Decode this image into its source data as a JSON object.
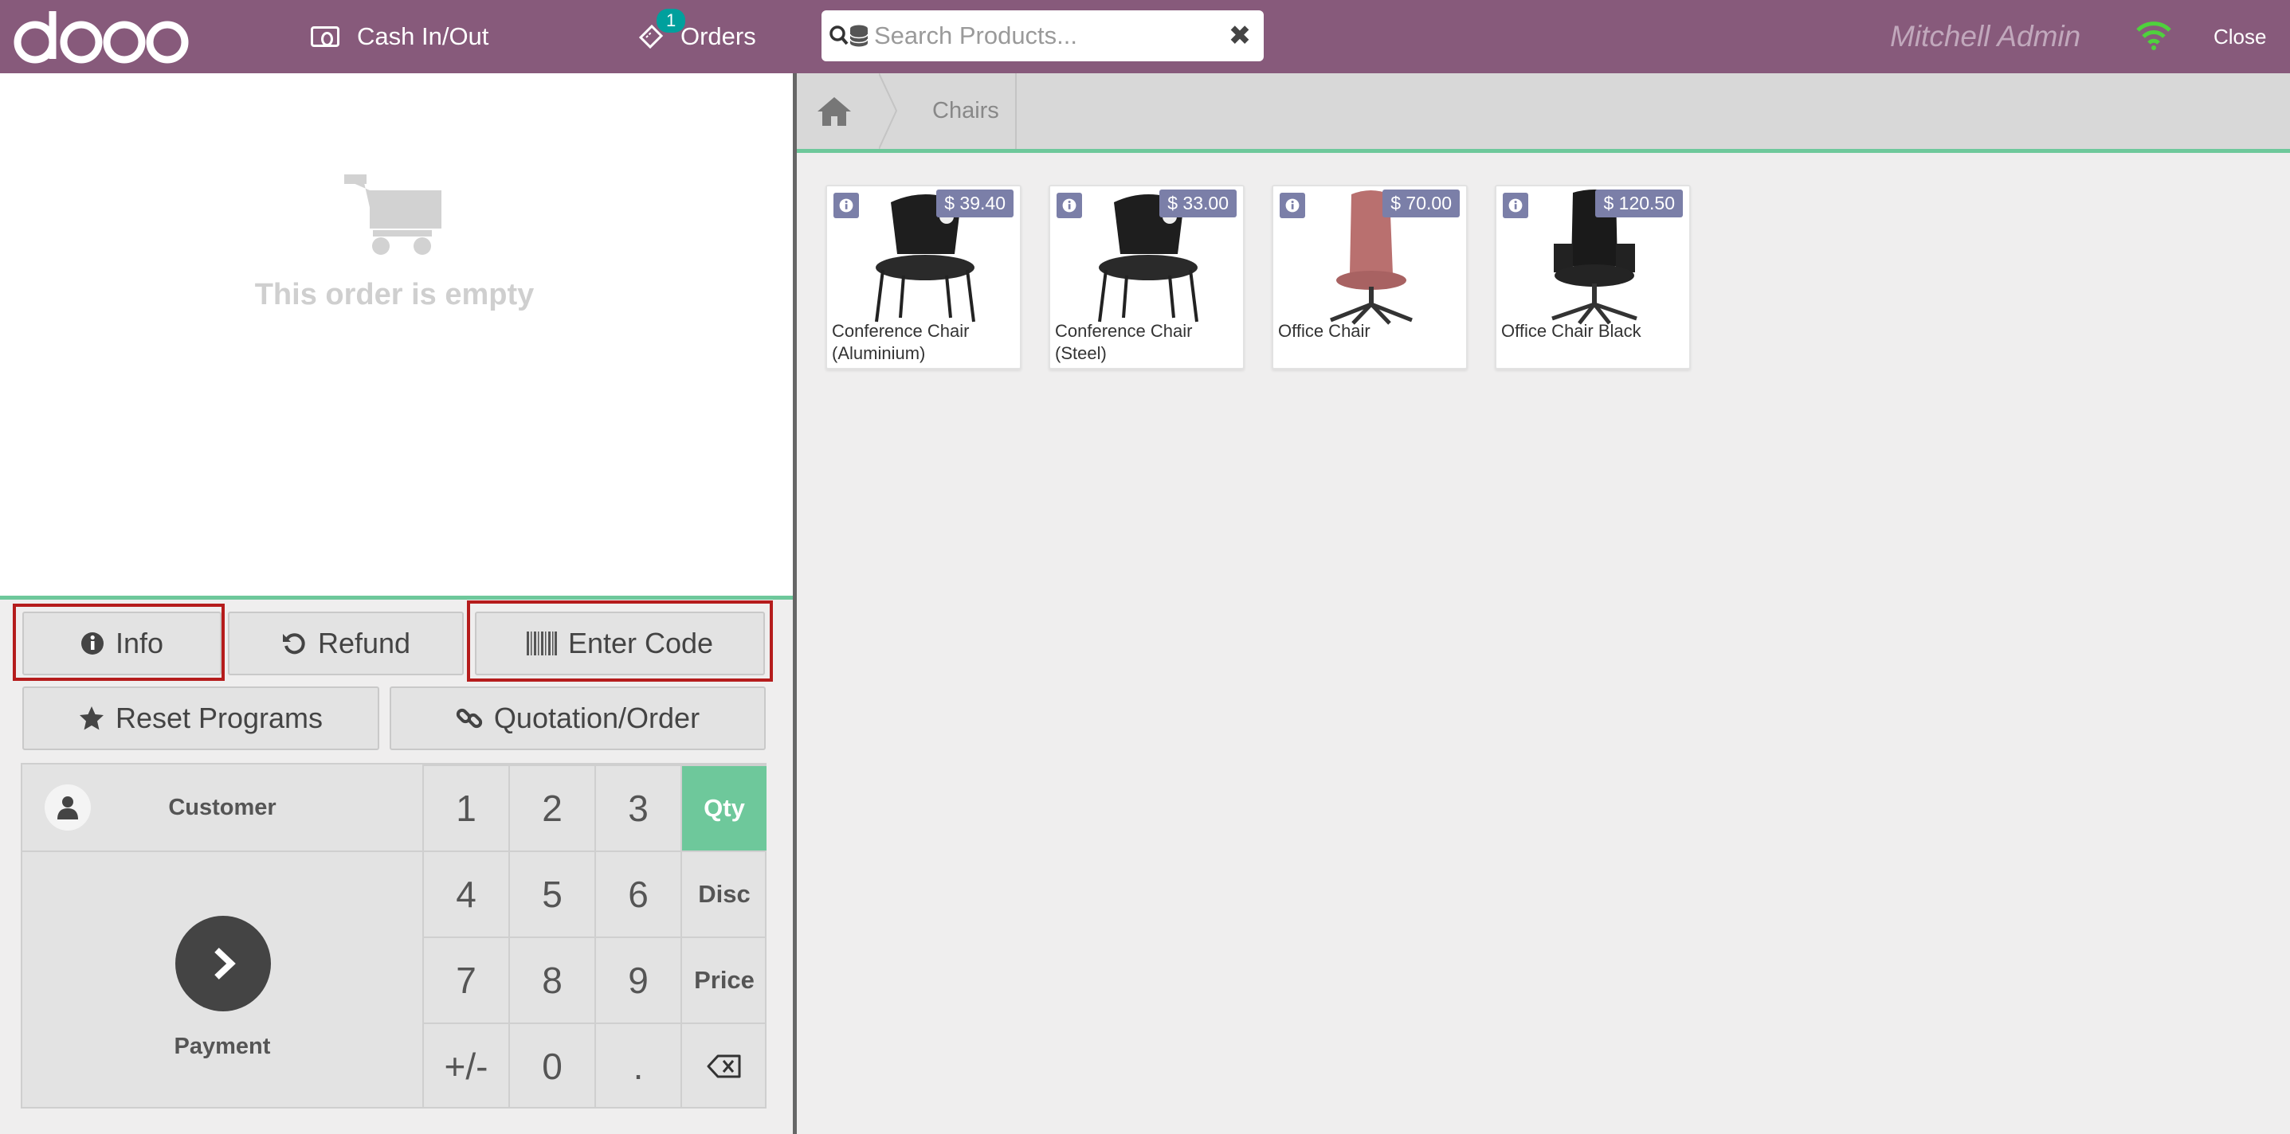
{
  "topbar": {
    "logo_text": "odoo",
    "cash_label": "Cash In/Out",
    "orders_label": "Orders",
    "orders_badge": "1",
    "search_placeholder": "Search Products...",
    "user_name": "Mitchell Admin",
    "close_label": "Close"
  },
  "order": {
    "empty_text": "This order is empty"
  },
  "controls": {
    "info_label": "Info",
    "refund_label": "Refund",
    "enter_code_label": "Enter Code",
    "reset_programs_label": "Reset Programs",
    "quotation_label": "Quotation/Order"
  },
  "keypad": {
    "customer_label": "Customer",
    "payment_label": "Payment",
    "keys": [
      "1",
      "2",
      "3",
      "4",
      "5",
      "6",
      "7",
      "8",
      "9",
      "+/-",
      "0",
      "."
    ],
    "modes": [
      "Qty",
      "Disc",
      "Price"
    ],
    "active_mode": "Qty"
  },
  "breadcrumb": {
    "category": "Chairs"
  },
  "products": [
    {
      "name": "Conference Chair (Aluminium)",
      "price": "$ 39.40"
    },
    {
      "name": "Conference Chair (Steel)",
      "price": "$ 33.00"
    },
    {
      "name": "Office Chair",
      "price": "$ 70.00"
    },
    {
      "name": "Office Chair Black",
      "price": "$ 120.50"
    }
  ],
  "colors": {
    "topbar": "#875a7b",
    "accent_green": "#6ec89b",
    "price_badge": "#7b7fa8",
    "highlight_red": "#b51c1c"
  }
}
